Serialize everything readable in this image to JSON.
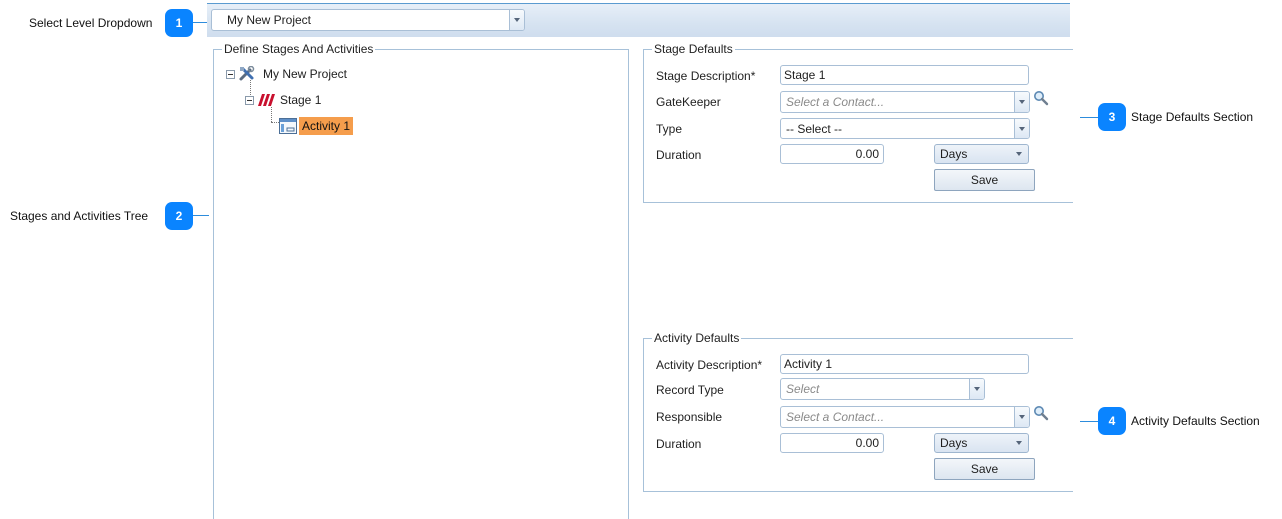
{
  "callouts": [
    {
      "number": "1",
      "label": "Select Level Dropdown"
    },
    {
      "number": "2",
      "label": "Stages and Activities Tree"
    },
    {
      "number": "3",
      "label": "Stage Defaults Section"
    },
    {
      "number": "4",
      "label": "Activity Defaults Section"
    }
  ],
  "level_select": {
    "value": "My New Project"
  },
  "tree": {
    "title": "Define Stages And Activities",
    "nodes": [
      {
        "label": "My New Project",
        "icon": "project-tools-icon",
        "expanded": true
      },
      {
        "label": "Stage 1",
        "icon": "stage-stripes-icon",
        "expanded": true
      },
      {
        "label": "Activity 1",
        "icon": "activity-window-icon",
        "selected": true
      }
    ]
  },
  "stage_defaults": {
    "title": "Stage Defaults",
    "description_label": "Stage Description*",
    "description_value": "Stage 1",
    "gatekeeper_label": "GateKeeper",
    "gatekeeper_placeholder": "Select a Contact...",
    "type_label": "Type",
    "type_value": "-- Select --",
    "duration_label": "Duration",
    "duration_value": "0.00",
    "duration_unit": "Days",
    "save_label": "Save"
  },
  "activity_defaults": {
    "title": "Activity Defaults",
    "description_label": "Activity Description*",
    "description_value": "Activity 1",
    "record_type_label": "Record Type",
    "record_type_placeholder": "Select",
    "responsible_label": "Responsible",
    "responsible_placeholder": "Select a Contact...",
    "duration_label": "Duration",
    "duration_value": "0.00",
    "duration_unit": "Days",
    "save_label": "Save"
  },
  "colors": {
    "badge": "#0a84ff",
    "selected_node": "#f59d4c",
    "group_border": "#a7c1d9"
  }
}
